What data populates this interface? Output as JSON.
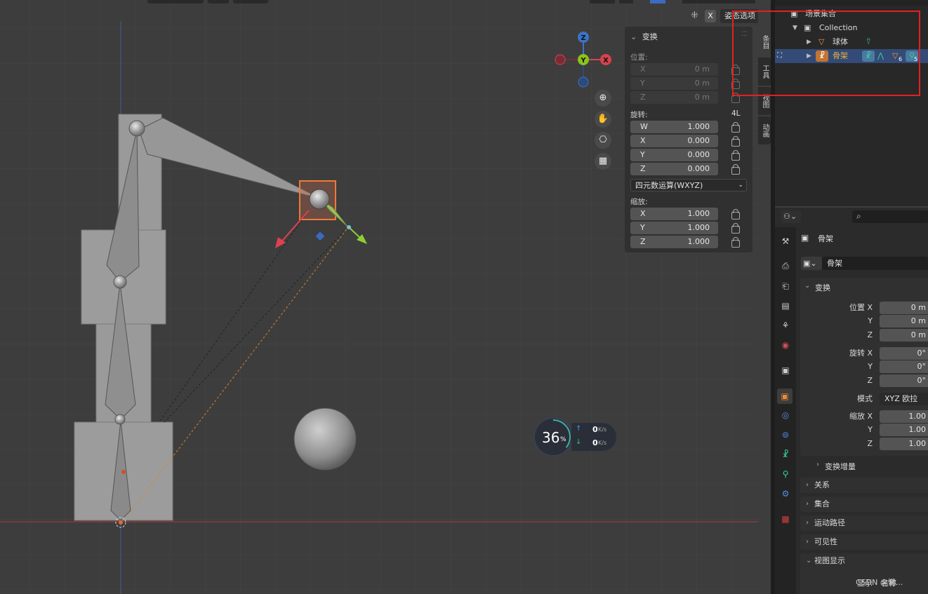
{
  "header": {
    "pose_options_label": "姿态选项",
    "x_button_label": "X"
  },
  "gizmo_axes": {
    "z": "Z",
    "y": "Y",
    "x": "X"
  },
  "npanel": {
    "title": "变换",
    "location_label": "位置:",
    "location": [
      {
        "axis": "X",
        "value": "0 m"
      },
      {
        "axis": "Y",
        "value": "0 m"
      },
      {
        "axis": "Z",
        "value": "0 m"
      }
    ],
    "rotation_label": "旋转:",
    "rotation_mode_tag": "4L",
    "rotation": [
      {
        "axis": "W",
        "value": "1.000"
      },
      {
        "axis": "X",
        "value": "0.000"
      },
      {
        "axis": "Y",
        "value": "0.000"
      },
      {
        "axis": "Z",
        "value": "0.000"
      }
    ],
    "rotation_mode": "四元数运算(WXYZ)",
    "scale_label": "缩放:",
    "scale": [
      {
        "axis": "X",
        "value": "1.000"
      },
      {
        "axis": "Y",
        "value": "1.000"
      },
      {
        "axis": "Z",
        "value": "1.000"
      }
    ]
  },
  "side_tabs": [
    "条目",
    "工具",
    "视图",
    "动画"
  ],
  "outliner": {
    "scene_collection": "场景集合",
    "collection": "Collection",
    "sphere": "球体",
    "armature": "骨架",
    "badge_mesh": "6",
    "badge_bone": "5"
  },
  "perf": {
    "percent": "36",
    "percent_unit": "%",
    "up": "0",
    "down": "0",
    "unit": "K/s"
  },
  "properties": {
    "object_name": "骨架",
    "object_data_name": "骨架",
    "transform_section": "变换",
    "location_label": "位置 X",
    "location": [
      "0 m",
      "0 m",
      "0 m"
    ],
    "rotation_label": "旋转 X",
    "rotation": [
      "0°",
      "0°",
      "0°"
    ],
    "mode_label": "模式",
    "mode_value": "XYZ 欧拉",
    "scale_label": "缩放 X",
    "scale": [
      "1.00",
      "1.00",
      "1.00"
    ],
    "axis_y": "Y",
    "axis_z": "Z",
    "delta_transform": "变换增量",
    "sections": [
      "关系",
      "集合",
      "运动路径",
      "可见性",
      "视图显示"
    ],
    "display_label": "显示",
    "display_value": "名称"
  },
  "watermark": "CSDN @懒..."
}
